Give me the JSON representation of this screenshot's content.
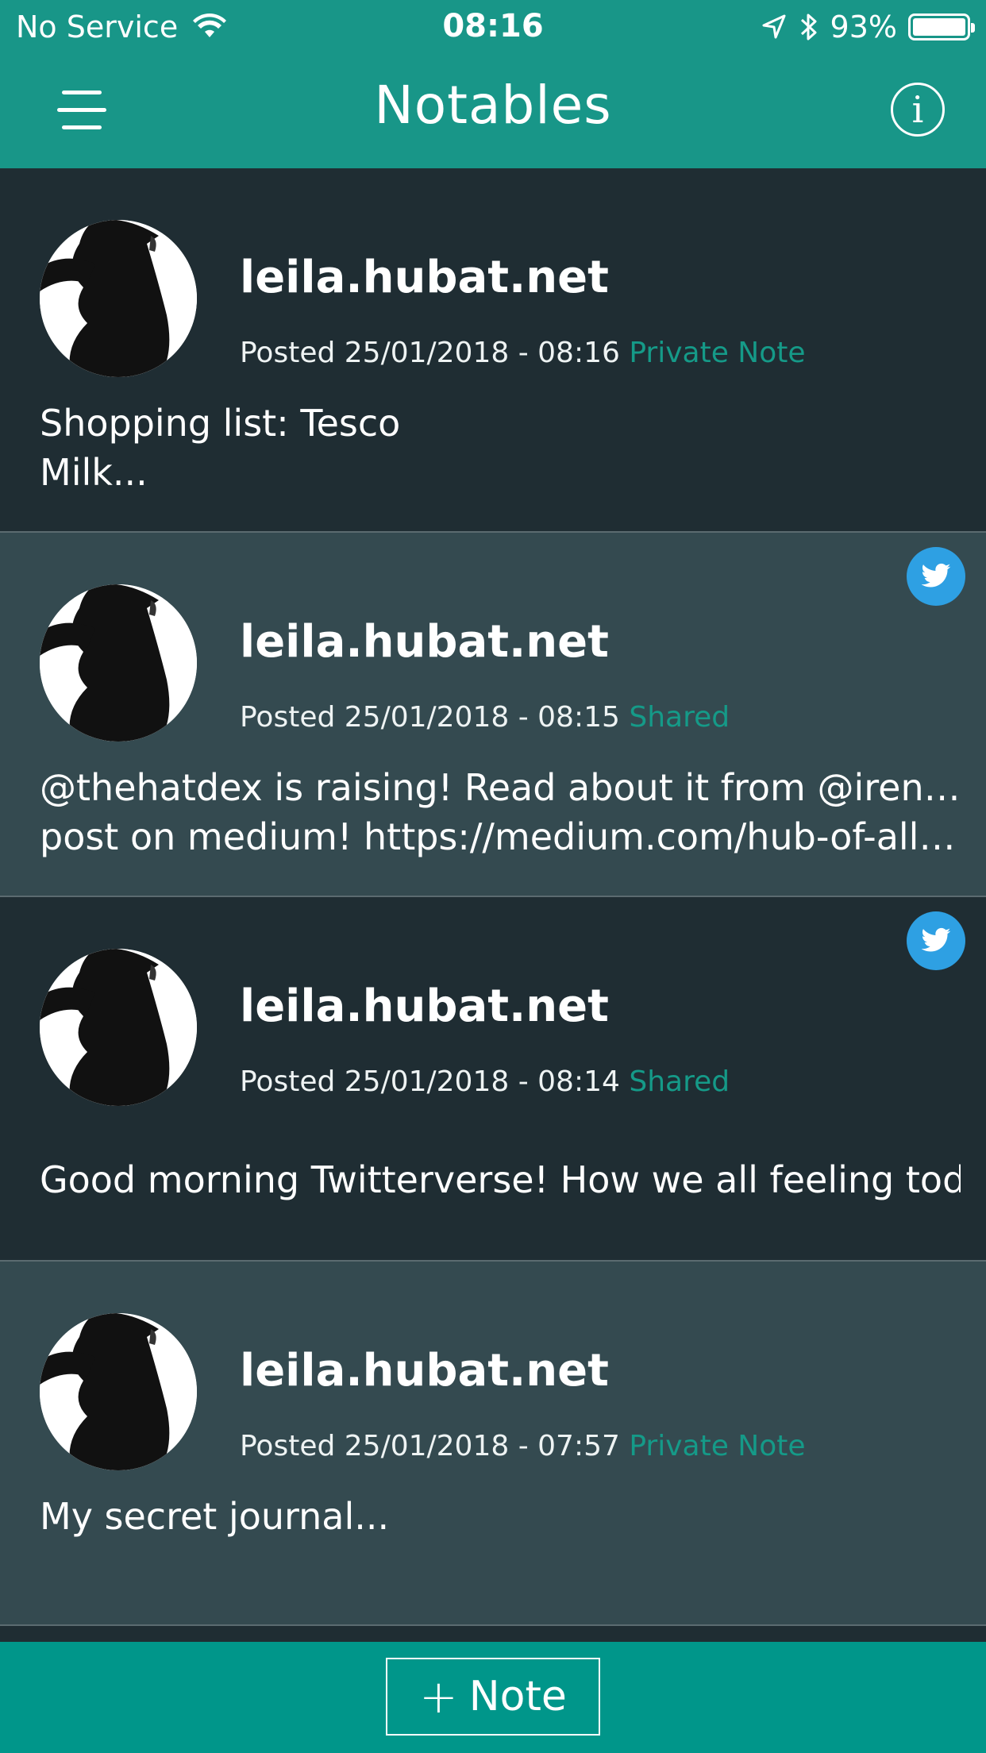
{
  "status_bar": {
    "carrier": "No Service",
    "time": "08:16",
    "battery_percent": "93%",
    "battery_level": 0.93
  },
  "nav": {
    "title": "Notables",
    "menu_icon": "hamburger-menu-icon",
    "info_icon": "info-icon",
    "info_glyph": "i"
  },
  "notes": [
    {
      "author": "leila.hubat.net",
      "posted": "Posted 25/01/2018 - 08:16",
      "type": "Private Note",
      "body": "Shopping list: Tesco\nMilk...",
      "shared_to_twitter": false
    },
    {
      "author": "leila.hubat.net",
      "posted": "Posted 25/01/2018 - 08:15",
      "type": "Shared",
      "body_line1": "@thehatdex is raising! Read about it from @ireneclng",
      "body_line2": "post on medium! https://medium.com/hub-of-all-thi...",
      "shared_to_twitter": true
    },
    {
      "author": "leila.hubat.net",
      "posted": "Posted 25/01/2018 - 08:14",
      "type": "Shared",
      "body": "Good morning Twitterverse! How we all feeling today?",
      "shared_to_twitter": true
    },
    {
      "author": "leila.hubat.net",
      "posted": "Posted 25/01/2018 - 07:57",
      "type": "Private Note",
      "body": "My secret journal...",
      "shared_to_twitter": false
    }
  ],
  "bottom_bar": {
    "add_note_plus": "+",
    "add_note_label": "Note"
  },
  "colors": {
    "primary": "#189688",
    "accent_text": "#159a88",
    "card_dark": "#1f2d33",
    "card_light": "#344a50",
    "twitter": "#2ea0e3"
  }
}
